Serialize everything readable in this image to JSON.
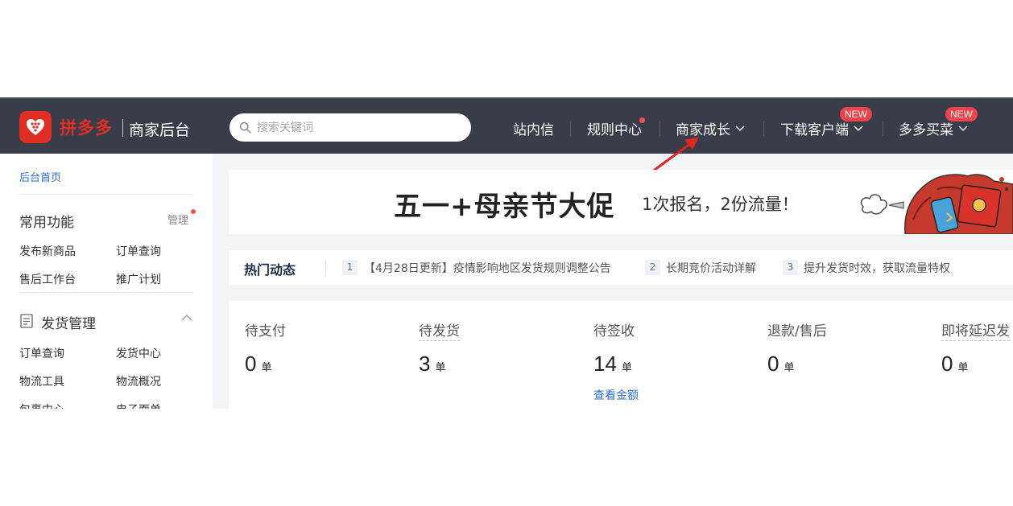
{
  "header": {
    "brand": "拼多多",
    "brand_sub": "商家后台",
    "search_placeholder": "搜索关键词",
    "nav": [
      {
        "label": "站内信"
      },
      {
        "label": "规则中心"
      },
      {
        "label": "商家成长"
      },
      {
        "label": "下载客户端",
        "badge": "NEW"
      },
      {
        "label": "多多买菜",
        "badge": "NEW"
      }
    ]
  },
  "sidebar": {
    "home": "后台首页",
    "common": {
      "title": "常用功能",
      "manage": "管理",
      "links": [
        "发布新商品",
        "订单查询",
        "售后工作台",
        "推广计划"
      ]
    },
    "shipping": {
      "title": "发货管理",
      "links": [
        "订单查询",
        "发货中心",
        "物流工具",
        "物流概况",
        "包裹中心",
        "电子面单"
      ]
    }
  },
  "banner": {
    "title": "五一+母亲节大促",
    "subtitle": "1次报名，2份流量！"
  },
  "hot": {
    "title": "热门动态",
    "items": [
      {
        "num": "1",
        "text": "【4月28日更新】疫情影响地区发货规则调整公告"
      },
      {
        "num": "2",
        "text": "长期竞价活动详解"
      },
      {
        "num": "3",
        "text": "提升发货时效，获取流量特权"
      }
    ]
  },
  "orders": {
    "unit": "单",
    "items": [
      {
        "label": "待支付",
        "value": "0"
      },
      {
        "label": "待发货",
        "value": "3"
      },
      {
        "label": "待签收",
        "value": "14"
      },
      {
        "label": "退款/售后",
        "value": "0"
      },
      {
        "label": "即将延迟发",
        "value": "0"
      }
    ],
    "amount_link": "查看金额"
  },
  "colors": {
    "header_bg": "#393d49",
    "brand_red": "#e02e24",
    "link_blue": "#2d6fd1",
    "badge_red": "#f0424a"
  }
}
